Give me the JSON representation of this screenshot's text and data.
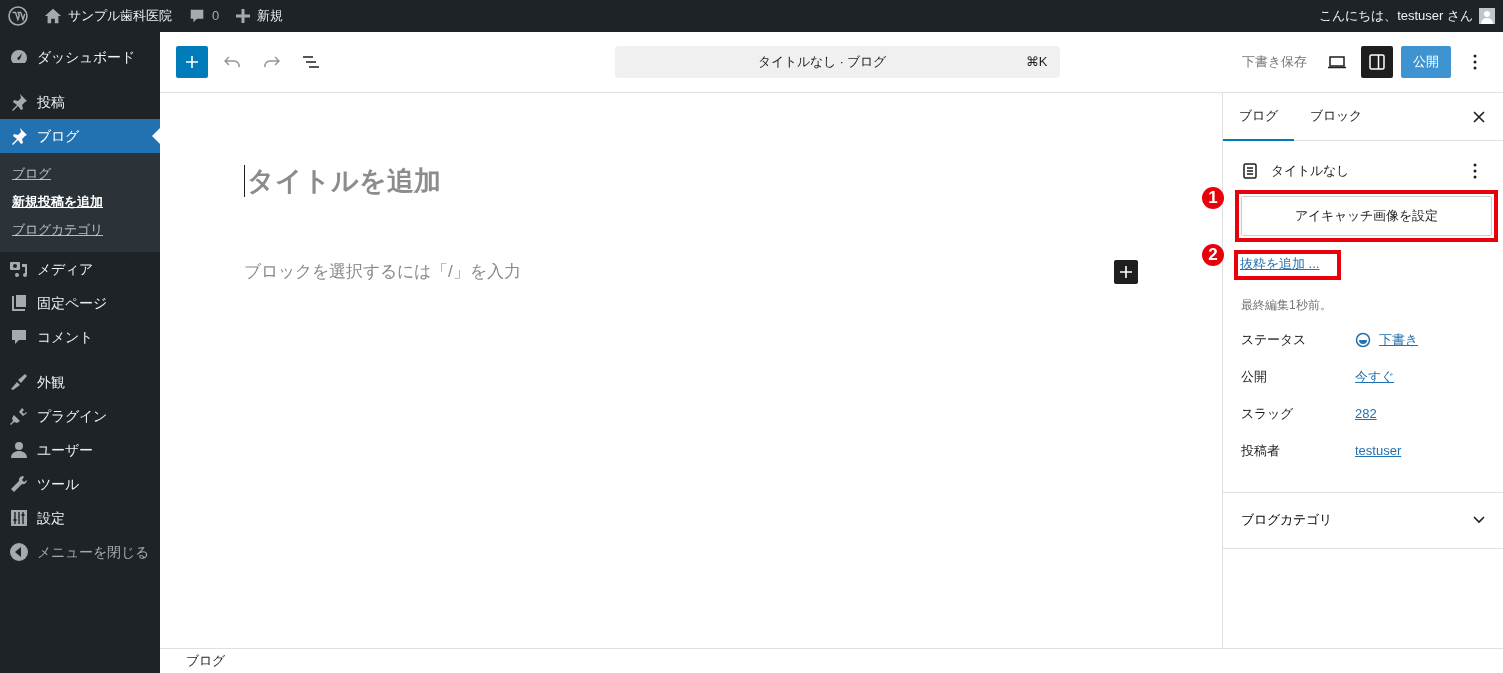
{
  "admin_bar": {
    "site_name": "サンプル歯科医院",
    "comment_count": "0",
    "new_label": "新規",
    "greeting": "こんにちは、testuser さん"
  },
  "admin_menu": [
    {
      "label": "ダッシュボード",
      "selected": false
    },
    {
      "label": "投稿",
      "selected": false
    },
    {
      "label": "ブログ",
      "selected": true,
      "children": [
        {
          "label": "ブログ",
          "selected": false
        },
        {
          "label": "新規投稿を追加",
          "selected": true
        },
        {
          "label": "ブログカテゴリ",
          "selected": false
        }
      ]
    },
    {
      "label": "メディア",
      "selected": false
    },
    {
      "label": "固定ページ",
      "selected": false
    },
    {
      "label": "コメント",
      "selected": false
    },
    {
      "label": "外観",
      "selected": false
    },
    {
      "label": "プラグイン",
      "selected": false
    },
    {
      "label": "ユーザー",
      "selected": false
    },
    {
      "label": "ツール",
      "selected": false
    },
    {
      "label": "設定",
      "selected": false
    },
    {
      "label": "メニューを閉じる",
      "selected": false
    }
  ],
  "toolbar": {
    "command_bar": "タイトルなし · ブログ",
    "shortcut": "⌘K",
    "save_draft": "下書き保存",
    "settings_open": true,
    "publish": "公開"
  },
  "editor": {
    "title_placeholder": "タイトルを追加",
    "block_placeholder": "ブロックを選択するには「/」を入力"
  },
  "settings_panel": {
    "tabs": [
      {
        "label": "ブログ",
        "selected": true
      },
      {
        "label": "ブロック",
        "selected": false
      }
    ],
    "document_title": "タイトルなし",
    "featured_image_button": {
      "label": "アイキャッチ画像を設定",
      "annotation": "1"
    },
    "excerpt_link": {
      "label": "抜粋を追加 ...",
      "annotation": "2"
    },
    "last_edited": "最終編集1秒前。",
    "fields": [
      {
        "label": "ステータス",
        "value": "下書き",
        "kind": "status"
      },
      {
        "label": "公開",
        "value": "今すぐ",
        "kind": "link"
      },
      {
        "label": "スラッグ",
        "value": "282",
        "kind": "link"
      },
      {
        "label": "投稿者",
        "value": "testuser",
        "kind": "link"
      }
    ],
    "sections": [
      {
        "label": "ブログカテゴリ",
        "expanded": false
      }
    ]
  },
  "footer": {
    "breadcrumb": "ブログ"
  }
}
